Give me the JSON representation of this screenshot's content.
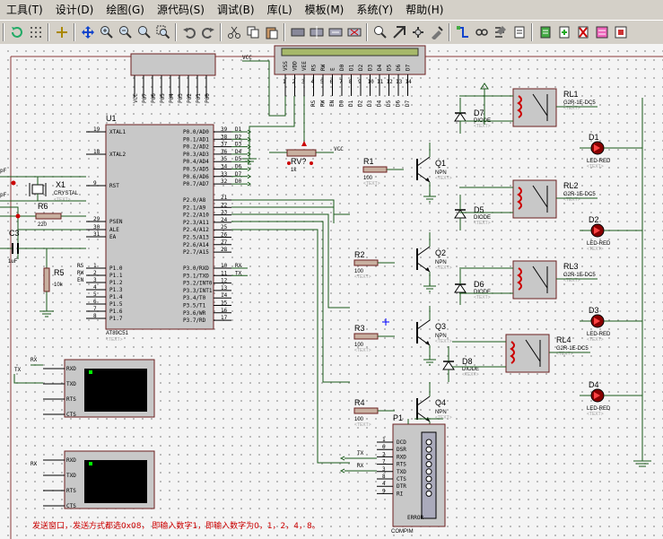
{
  "menu": [
    {
      "label": "工具(T)"
    },
    {
      "label": "设计(D)"
    },
    {
      "label": "绘图(G)"
    },
    {
      "label": "源代码(S)"
    },
    {
      "label": "调试(B)"
    },
    {
      "label": "库(L)"
    },
    {
      "label": "模板(M)"
    },
    {
      "label": "系统(Y)"
    },
    {
      "label": "帮助(H)"
    }
  ],
  "schematic": {
    "mcu_ref": "U1",
    "mcu_part": "AT89C51",
    "text_tag": "<TEXT>",
    "mcu_left_pins": [
      "XTAL1",
      "XTAL2",
      "RST",
      "PSEN",
      "ALE",
      "EA",
      "P1.0",
      "P1.1",
      "P1.2",
      "P1.3",
      "P1.4",
      "P1.5",
      "P1.6",
      "P1.7"
    ],
    "mcu_right_pins": [
      "P0.0/AD0",
      "P0.1/AD1",
      "P0.2/AD2",
      "P0.3/AD3",
      "P0.4/AD4",
      "P0.5/AD5",
      "P0.6/AD6",
      "P0.7/AD7",
      "P2.0/A8",
      "P2.1/A9",
      "P2.2/A10",
      "P2.3/A11",
      "P2.4/A12",
      "P2.5/A13",
      "P2.6/A14",
      "P2.7/A15",
      "P3.0/RXD",
      "P3.1/TXD",
      "P3.2/INT0",
      "P3.3/INT1",
      "P3.4/T0",
      "P3.5/T1",
      "P3.6/WR",
      "P3.7/RD"
    ],
    "mcu_left_nums": [
      "19",
      "18",
      "9",
      "29",
      "30",
      "31",
      "1",
      "2",
      "3",
      "4",
      "5",
      "6",
      "7",
      "8"
    ],
    "mcu_right_nums": [
      "39",
      "38",
      "37",
      "36",
      "35",
      "34",
      "33",
      "32",
      "21",
      "22",
      "23",
      "24",
      "25",
      "26",
      "27",
      "28",
      "10",
      "11",
      "12",
      "13",
      "14",
      "15",
      "16",
      "17"
    ],
    "p0_nets": [
      "D1",
      "D2",
      "D3",
      "D4",
      "D5",
      "D6",
      "D7",
      "D0"
    ],
    "p3_nets": [
      "RX",
      "TX"
    ],
    "p1_nets": [
      "RS",
      "RW",
      "EN"
    ],
    "lcd_pins": [
      "VSS",
      "VDD",
      "VEE",
      "RS",
      "RW",
      "E",
      "D0",
      "D1",
      "D2",
      "D3",
      "D4",
      "D5",
      "D6",
      "D7"
    ],
    "lcd_pin_nums": [
      "1",
      "2",
      "3",
      "4",
      "5",
      "6",
      "7",
      "8",
      "9",
      "10",
      "11",
      "12",
      "13",
      "14"
    ],
    "lcd_nets": [
      "RS",
      "RW",
      "EN",
      "D0",
      "D1",
      "D2",
      "D3",
      "D4",
      "D5",
      "D6",
      "D7"
    ],
    "header_pins": [
      "VCC",
      "P07",
      "P06",
      "P05",
      "P04",
      "P03",
      "P02",
      "P01",
      "P00"
    ],
    "vcc": "VCC",
    "rv_ref": "RV?",
    "rv_val": "1k",
    "crystal": {
      "ref": "X1",
      "val": "CRYSTAL"
    },
    "r6": {
      "ref": "R6",
      "val": "220"
    },
    "c3": {
      "ref": "C3",
      "val": "1uF"
    },
    "r5": {
      "ref": "R5",
      "val": "10k"
    },
    "cap_label": "pF",
    "resistors": [
      {
        "ref": "R1",
        "val": "100"
      },
      {
        "ref": "R2",
        "val": "100"
      },
      {
        "ref": "R3",
        "val": "100"
      },
      {
        "ref": "R4",
        "val": "100"
      }
    ],
    "transistors": [
      {
        "ref": "Q1",
        "type": "NPN"
      },
      {
        "ref": "Q2",
        "type": "NPN"
      },
      {
        "ref": "Q3",
        "type": "NPN"
      },
      {
        "ref": "Q4",
        "type": "NPN"
      }
    ],
    "diodes": [
      {
        "ref": "D7",
        "type": "DIODE"
      },
      {
        "ref": "D5",
        "type": "DIODE"
      },
      {
        "ref": "D6",
        "type": "DIODE"
      },
      {
        "ref": "D8",
        "type": "DIODE"
      }
    ],
    "relays": [
      {
        "ref": "RL1",
        "part": "G2R-1E-DC5"
      },
      {
        "ref": "RL2",
        "part": "G2R-1E-DC5"
      },
      {
        "ref": "RL3",
        "part": "G2R-1E-DC5"
      },
      {
        "ref": "RL4",
        "part": "G2R-1E-DC5"
      }
    ],
    "leds": [
      {
        "ref": "D1",
        "type": "LED-RED"
      },
      {
        "ref": "D2",
        "type": "LED-RED"
      },
      {
        "ref": "D3",
        "type": "LED-RED"
      },
      {
        "ref": "D4",
        "type": "LED-RED"
      }
    ],
    "terminal_pins": [
      "RXD",
      "TXD",
      "RTS",
      "CTS"
    ],
    "terminal_nets": [
      "RX",
      "TX"
    ],
    "compim": {
      "ref": "P1",
      "part": "COMPIM",
      "pins": [
        "DCD",
        "DSR",
        "RXD",
        "RTS",
        "TXD",
        "CTS",
        "DTR",
        "RI"
      ],
      "nums": [
        "1",
        "6",
        "2",
        "7",
        "3",
        "8",
        "4",
        "9"
      ],
      "error": "ERROR"
    },
    "note": "发送窗口，发送方式都选0x08，  即输入数字1，即输入数字为0，1，2，4，8。"
  }
}
